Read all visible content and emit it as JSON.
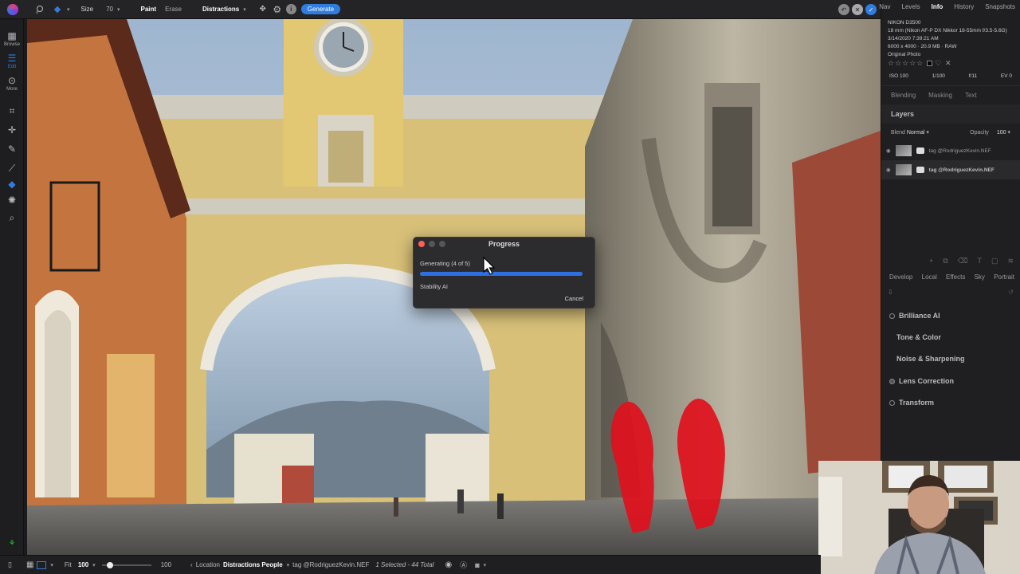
{
  "toolbar": {
    "size_label": "Size",
    "size_value": "70",
    "paint_label": "Paint",
    "erase_label": "Erase",
    "mode_dropdown": "Distractions",
    "generate_label": "Generate",
    "info_glyph": "i"
  },
  "left_toolbar": {
    "items": [
      {
        "icon": "grid-icon",
        "label": "Browse"
      },
      {
        "icon": "sliders-icon",
        "label": "Edit"
      },
      {
        "icon": "more-icon",
        "label": "More"
      }
    ]
  },
  "right_panel": {
    "tabs": [
      "Nav",
      "Levels",
      "Info",
      "History",
      "Snapshots"
    ],
    "active_tab": "Info",
    "camera": "NIKON D3500",
    "lens": "18 mm (Nikon AF-P DX Nikkor 18-55mm f/3.5-5.6G)",
    "datetime": "3/14/2020 7:39:21 AM",
    "dimensions": "6000 x 4000 · 20.9 MB · RAW",
    "original": "Original Photo",
    "exif": {
      "iso": "ISO 100",
      "shutter": "1/100",
      "aperture": "f/11",
      "ev": "EV 0"
    },
    "sub_tabs": [
      "Blending",
      "Masking",
      "Text"
    ],
    "layers_title": "Layers",
    "blend_label": "Blend",
    "blend_value": "Normal",
    "opacity_label": "Opacity",
    "opacity_value": "100",
    "layers": [
      {
        "name": "tag @RodriguezKevin.NEF",
        "selected": false
      },
      {
        "name": "tag @RodriguezKevin.NEF",
        "selected": true
      }
    ],
    "module_tabs": [
      "Develop",
      "Local",
      "Effects",
      "Sky",
      "Portrait"
    ],
    "adjustments": [
      {
        "name": "Brilliance AI",
        "radio": true
      },
      {
        "name": "Tone & Color",
        "radio": false
      },
      {
        "name": "Noise & Sharpening",
        "radio": false
      },
      {
        "name": "Lens Correction",
        "radio": true
      },
      {
        "name": "Transform",
        "radio": true
      }
    ]
  },
  "dialog": {
    "title": "Progress",
    "status": "Generating (4 of 5)",
    "progress": 1.0,
    "provider": "Stability AI",
    "cancel_label": "Cancel"
  },
  "bottom_bar": {
    "fit_label": "Fit",
    "zoom_value": "100",
    "slider_value_label": "100",
    "slider_fraction": 0.1,
    "location_label": "Location",
    "album": "Distractions People",
    "tag": "tag @RodriguezKevin.NEF",
    "selection": "1 Selected - 44 Total"
  },
  "colors": {
    "accent": "#2f7de1",
    "mask": "#e0101c",
    "close": "#ff5f57"
  }
}
